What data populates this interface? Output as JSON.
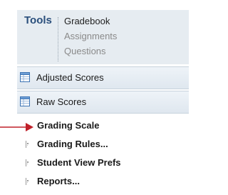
{
  "tools": {
    "title": "Tools",
    "links": [
      "Gradebook",
      "Assignments",
      "Questions"
    ]
  },
  "scores": [
    {
      "label": "Adjusted Scores",
      "icon": "table-icon"
    },
    {
      "label": "Raw Scores",
      "icon": "table-icon"
    }
  ],
  "menu": [
    {
      "label": "Grading Scale",
      "icon": "dotted-handle-icon"
    },
    {
      "label": "Grading Rules...",
      "icon": "dotted-handle-icon"
    },
    {
      "label": "Student View Prefs",
      "icon": "dotted-handle-icon"
    },
    {
      "label": "Reports...",
      "icon": "dotted-handle-icon"
    }
  ],
  "colors": {
    "accent": "#2a4f7c",
    "pointer": "#c0202a",
    "header_bg": "#e6ecf1"
  }
}
